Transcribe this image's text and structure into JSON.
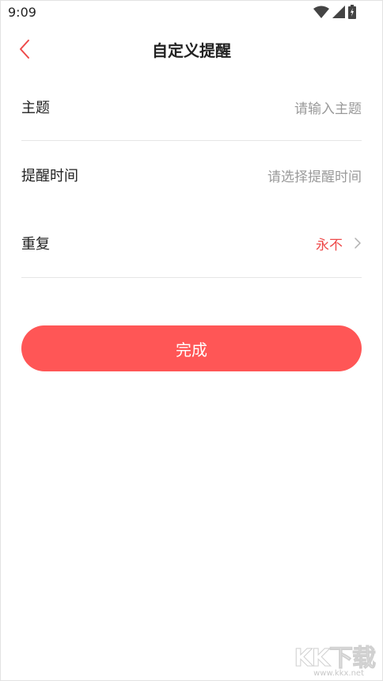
{
  "status_bar": {
    "time": "9:09",
    "icons": [
      "wifi-icon",
      "signal-icon",
      "battery-icon"
    ]
  },
  "header": {
    "title": "自定义提醒",
    "back_icon": "chevron-left-icon",
    "accent_color": "#ee4a4a"
  },
  "form": {
    "topic": {
      "label": "主题",
      "placeholder": "请输入主题"
    },
    "reminder_time": {
      "label": "提醒时间",
      "value": "请选择提醒时间"
    },
    "repeat": {
      "label": "重复",
      "value": "永不",
      "icon": "chevron-right-icon"
    }
  },
  "actions": {
    "done_label": "完成",
    "button_color": "#ff5656"
  },
  "watermark": {
    "logo": "KK下载",
    "url": "www.kkx.net"
  }
}
